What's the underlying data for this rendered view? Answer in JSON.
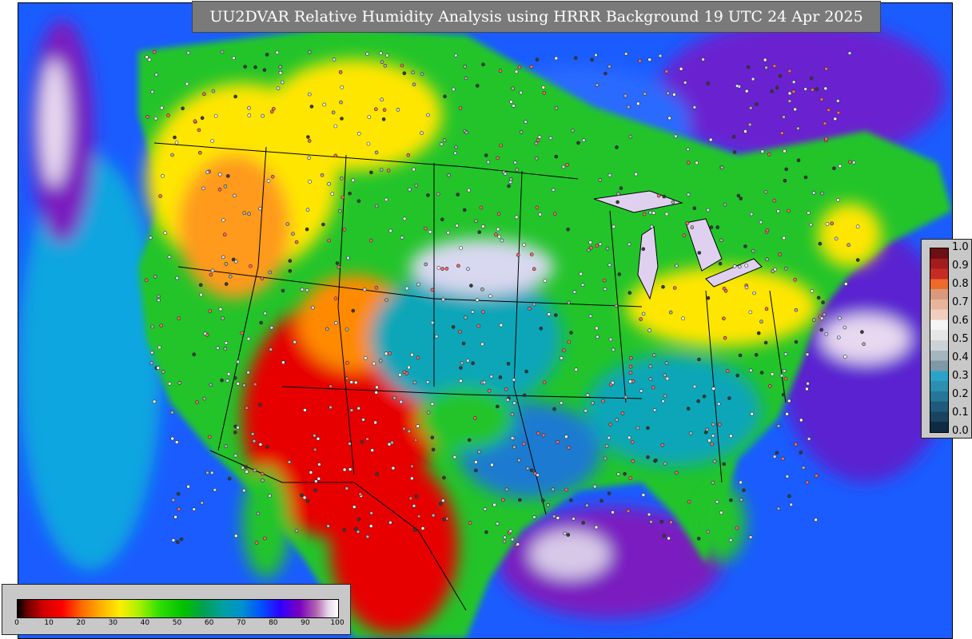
{
  "title": "UU2DVAR Relative Humidity Analysis using HRRR Background 19 UTC 24 Apr 2025",
  "right_legend": {
    "labels": [
      "1.0",
      "0.9",
      "0.8",
      "0.7",
      "0.6",
      "0.5",
      "0.4",
      "0.3",
      "0.2",
      "0.1",
      "0.0"
    ],
    "colors": [
      "#6e0f14",
      "#a31c1c",
      "#c62c25",
      "#ee6a2a",
      "#d9997e",
      "#e8b59a",
      "#f0cfbf",
      "#f5f5f5",
      "#e6e6e6",
      "#ccd3d8",
      "#a6b6bf",
      "#7e98a6",
      "#2ba3c9",
      "#2a8fb0",
      "#26769a",
      "#1f5a7c",
      "#184460",
      "#0f2b44"
    ]
  },
  "bottom_legend": {
    "ticks": [
      "0",
      "10",
      "20",
      "30",
      "40",
      "50",
      "60",
      "70",
      "80",
      "90",
      "100"
    ]
  },
  "colors": {
    "ocean_blue": "#1a5cff",
    "ocean_purple": "#7a1fc0",
    "land_green": "#22c42a",
    "land_yellow": "#ffe600",
    "land_orange": "#ff9a1a",
    "land_red": "#e60000",
    "land_cyan": "#0aa6b8"
  }
}
